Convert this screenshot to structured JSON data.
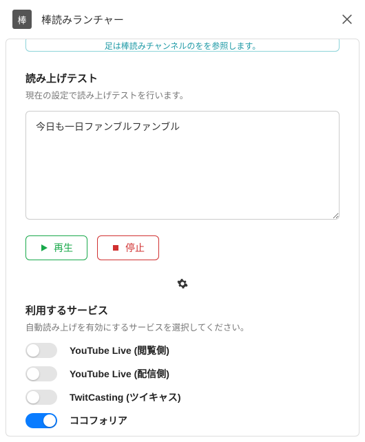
{
  "titlebar": {
    "icon_text": "棒",
    "title": "棒読みランチャー"
  },
  "notice": {
    "text": "足は棒読みチャンネルのをを参照します。"
  },
  "test_section": {
    "title": "読み上げテスト",
    "desc": "現在の設定で読み上げテストを行います。",
    "textarea_value": "今日も一日ファンブルファンブル",
    "play_label": "再生",
    "stop_label": "停止"
  },
  "services_section": {
    "title": "利用するサービス",
    "desc": "自動読み上げを有効にするサービスを選択してください。",
    "items": [
      {
        "label": "YouTube Live (閲覧側)",
        "on": false
      },
      {
        "label": "YouTube Live (配信側)",
        "on": false
      },
      {
        "label": "TwitCasting (ツイキャス)",
        "on": false
      },
      {
        "label": "ココフォリア",
        "on": true
      }
    ]
  }
}
